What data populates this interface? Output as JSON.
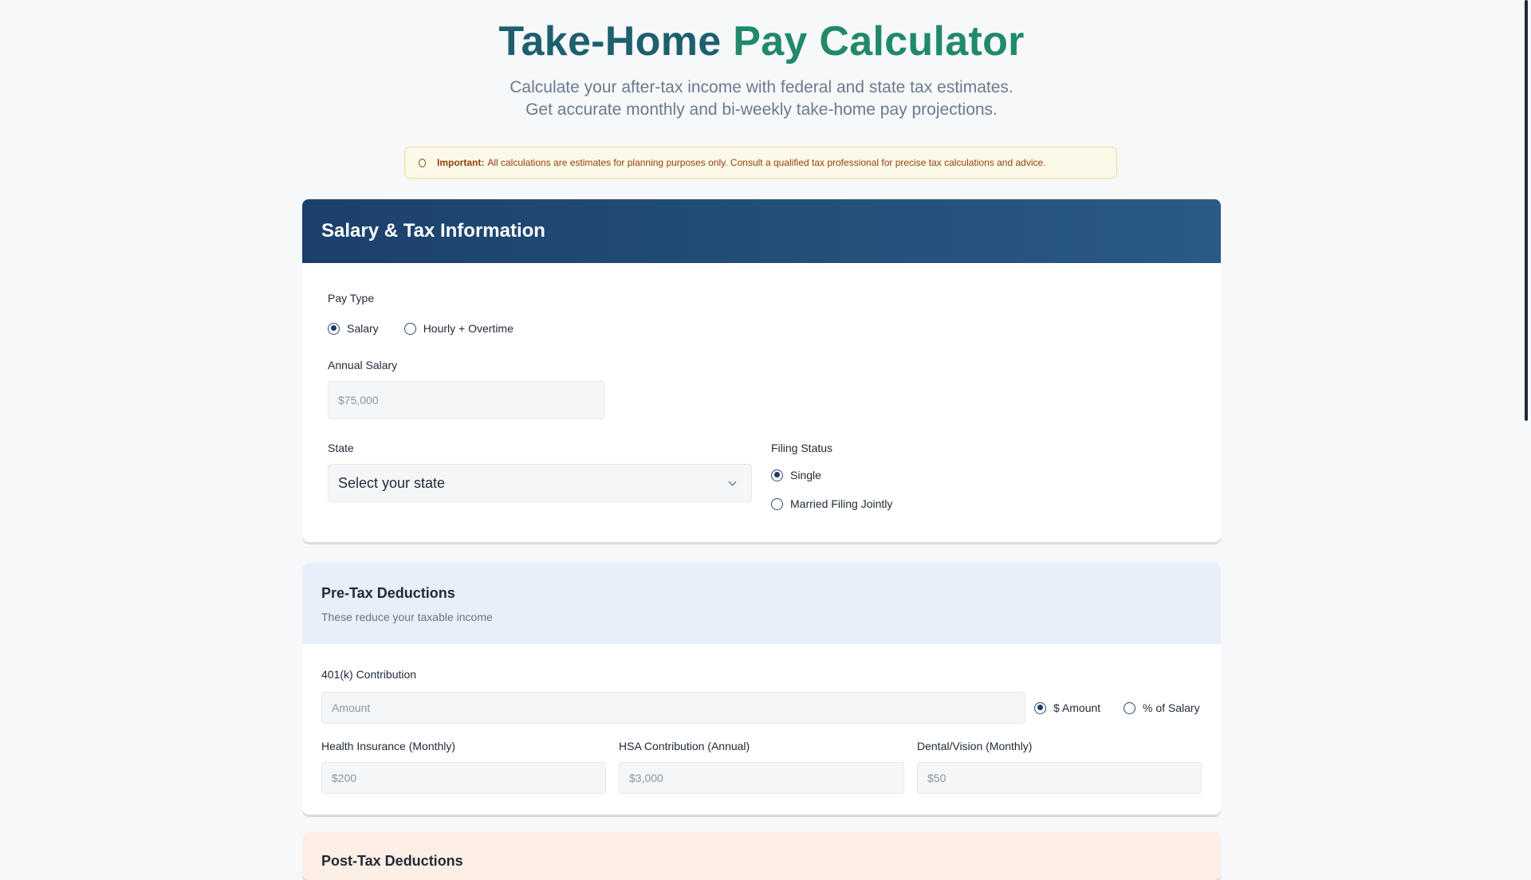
{
  "header": {
    "title_part1": "Take-Home",
    "title_part2": "Pay Calculator",
    "subtitle_line1": "Calculate your after-tax income with federal and state tax estimates.",
    "subtitle_line2": "Get accurate monthly and bi-weekly take-home pay projections."
  },
  "notice": {
    "icon": "info-icon",
    "strong": "Important:",
    "text": "All calculations are estimates for planning purposes only. Consult a qualified tax professional for precise tax calculations and advice."
  },
  "salary_card": {
    "title": "Salary & Tax Information",
    "pay_type": {
      "label": "Pay Type",
      "options": [
        "Salary",
        "Hourly + Overtime"
      ],
      "selected": "Salary"
    },
    "annual_salary": {
      "label": "Annual Salary",
      "placeholder": "$75,000",
      "value": ""
    },
    "state": {
      "label": "State",
      "selected": "Select your state"
    },
    "filing_status": {
      "label": "Filing Status",
      "options": [
        "Single",
        "Married Filing Jointly"
      ],
      "selected": "Single"
    }
  },
  "pretax_card": {
    "title": "Pre-Tax Deductions",
    "subtitle": "These reduce your taxable income",
    "k401": {
      "label": "401(k) Contribution",
      "placeholder": "Amount",
      "modes": [
        "$ Amount",
        "% of Salary"
      ],
      "selected_mode": "$ Amount"
    },
    "health": {
      "label": "Health Insurance (Monthly)",
      "placeholder": "$200"
    },
    "hsa": {
      "label": "HSA Contribution (Annual)",
      "placeholder": "$3,000"
    },
    "dental": {
      "label": "Dental/Vision (Monthly)",
      "placeholder": "$50"
    }
  },
  "posttax_card": {
    "title": "Post-Tax Deductions"
  },
  "colors": {
    "title_dark": "#1e5f6e",
    "title_green": "#21896a",
    "header_navy": "#1a416b",
    "pretax_bg": "#e9eefb",
    "posttax_bg": "#fdeee6",
    "notice_bg": "#fdf9e8"
  }
}
